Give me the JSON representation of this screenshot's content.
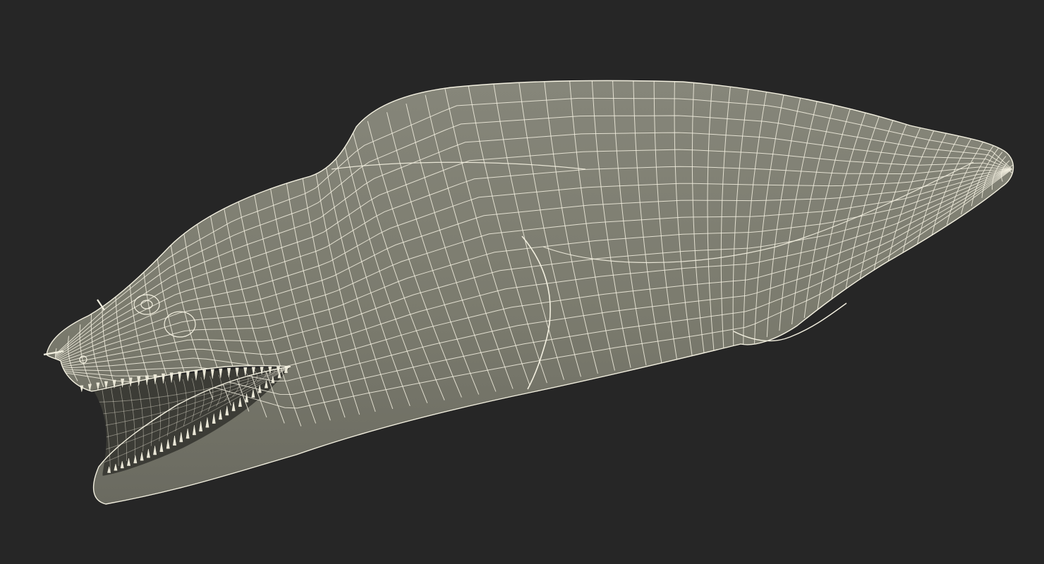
{
  "scene": {
    "subject": "moray-eel-wireframe-render",
    "background_color": "#262626",
    "surface_color": "#7d7d6f",
    "surface_dark_color": "#5f5f55",
    "mouth_interior_color": "#3c3c36",
    "wire_color": "#f3f0e0",
    "teeth_color": "#e9e6d6"
  }
}
